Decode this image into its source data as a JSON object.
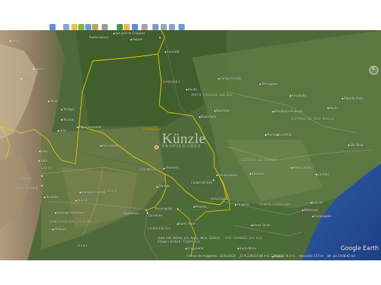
{
  "toolbar": {
    "buttons": [
      {
        "icon": "search-icon",
        "color": "#5b8fd4"
      },
      {
        "icon": "hide-sidebar-icon",
        "color": "#8aa7cf"
      },
      {
        "icon": "placemark-icon",
        "color": "#e8c54a"
      },
      {
        "icon": "polygon-icon",
        "color": "#8ab04e"
      },
      {
        "icon": "path-icon",
        "color": "#6f9ad8"
      },
      {
        "icon": "overlay-icon",
        "color": "#bfa25c"
      },
      {
        "icon": "record-tour-icon",
        "color": "#9a9a9a"
      },
      {
        "icon": "historical-imagery-icon",
        "color": "#3f9a50"
      },
      {
        "icon": "sun-icon",
        "color": "#f0b84a"
      },
      {
        "icon": "planets-icon",
        "color": "#5c8fd8"
      },
      {
        "icon": "ruler-icon",
        "color": "#a6a6a6"
      },
      {
        "icon": "email-icon",
        "color": "#7f9bbd"
      },
      {
        "icon": "print-icon",
        "color": "#9aa6b4"
      },
      {
        "icon": "save-image-icon",
        "color": "#8fa3bd"
      },
      {
        "icon": "view-in-maps-icon",
        "color": "#6d9ad0"
      }
    ]
  },
  "map": {
    "country_label": "Paraguay",
    "region_labels": [
      "KADIWÉU",
      "MATO GROSSO DO SUL",
      "ESTADO DE SÃO PAULO",
      "ESTADO DE PARANÁ",
      "SANTA CATARINA",
      "RIO GRANDE DO SUL",
      "FORMOSA",
      "CHACO",
      "SANTIAGO DEL ESTERO",
      "CORRIENTES",
      "MISIONES",
      "SALTA"
    ],
    "city_labels": [
      "San José de Chiquitos",
      "Corumbá",
      "Bonito",
      "Campo Grande",
      "Dourados",
      "Ponta Porã",
      "Três Lagoas",
      "Araçatuba",
      "Presidente Prudente",
      "Ribeirão Preto",
      "Bauru",
      "São Paulo",
      "Maringá",
      "Londrina",
      "Cascavel",
      "Ponta Grossa",
      "Curitiba",
      "Joinville",
      "Blumenau",
      "Florianópolis",
      "Chapecó",
      "Passo Fundo",
      "Santa Maria",
      "Posadas",
      "Encarnación",
      "Asunción",
      "Clorinda",
      "Resistencia",
      "Corrientes",
      "Tartagal",
      "Yacuiba",
      "Orán",
      "Jujuy",
      "Salta",
      "Tucumán",
      "Santiago del Estero",
      "Cafayate",
      "Tarija",
      "Sucre",
      "Potosí",
      "Uyuni",
      "Roboré",
      "Puerto Suárez",
      "Foz do Iguaçu",
      "Ciudad del Este",
      "Juan José Castelli",
      "Las Lomitas",
      "Ingeniero Juárez",
      "Monte Quemado",
      "Quimilí",
      "Añatuya",
      "Santo Tomé",
      "Uruguaiana",
      "Pelotas"
    ],
    "scale_bar": "113 km"
  },
  "watermark": {
    "name": "Künzle",
    "subtitle": "PROPIEDADES"
  },
  "credits": {
    "lines": [
      "Data SIO, NOAA, U.S. Navy, NGA, GEBCO",
      "Image Landsat / Copernicus"
    ],
    "logo": "Google Earth"
  },
  "status": {
    "imagery_date": "Fechas de imágenes: 12/31/2020",
    "coords": "21 K 236033.06 m E 7346839.78 m S",
    "elevation": "elevación   117 m",
    "eye_alt": "alt. ojo 1938.81 km"
  }
}
